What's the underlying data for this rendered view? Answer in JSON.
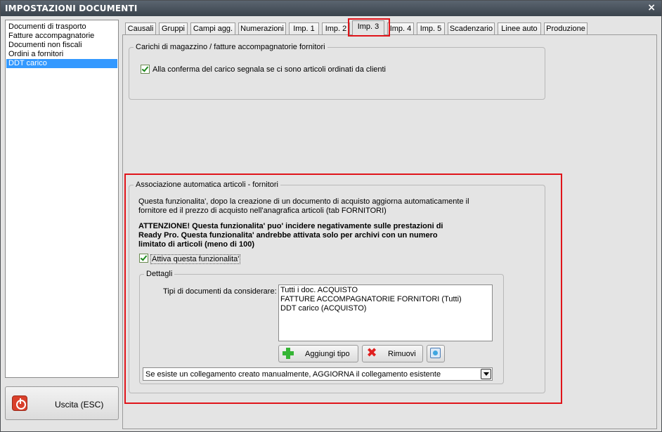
{
  "window": {
    "title": "IMPOSTAZIONI DOCUMENTI",
    "close_glyph": "×"
  },
  "doc_list": [
    {
      "label": "Documenti di trasporto",
      "selected": false
    },
    {
      "label": "Fatture accompagnatorie",
      "selected": false
    },
    {
      "label": "Documenti non fiscali",
      "selected": false
    },
    {
      "label": "Ordini a fornitori",
      "selected": false
    },
    {
      "label": "DDT carico",
      "selected": true
    }
  ],
  "exit_button": {
    "label": "Uscita (ESC)",
    "icon": "power-icon"
  },
  "tabs": [
    {
      "label": "Causali"
    },
    {
      "label": "Gruppi"
    },
    {
      "label": "Campi agg."
    },
    {
      "label": "Numerazioni"
    },
    {
      "label": "Imp. 1"
    },
    {
      "label": "Imp. 2"
    },
    {
      "label": "Imp. 3",
      "active": true
    },
    {
      "label": "Imp. 4"
    },
    {
      "label": "Imp. 5"
    },
    {
      "label": "Scadenzario"
    },
    {
      "label": "Linee auto"
    },
    {
      "label": "Produzione"
    }
  ],
  "carichi": {
    "legend": "Carichi di magazzino / fatture accompagnatorie fornitori",
    "checkbox_label": "Alla conferma del carico segnala se ci sono articoli ordinati da clienti",
    "checked": true
  },
  "associazione": {
    "legend": "Associazione automatica articoli - fornitori",
    "desc_line1": "Questa funzionalita', dopo la creazione di un documento di acquisto aggiorna automaticamente il",
    "desc_line2": "fornitore ed il prezzo di acquisto nell'anagrafica articoli (tab FORNITORI)",
    "warn_line1": "ATTENZIONE! Questa funzionalita' puo' incidere negativamente sulle prestazioni di",
    "warn_line2": "Ready Pro. Questa funzionalita' andrebbe attivata solo per archivi con un numero",
    "warn_line3": "limitato di articoli (meno di 100)",
    "activate_label": "Attiva questa funzionalita'",
    "activate_checked": true
  },
  "dettagli": {
    "legend": "Dettagli",
    "types_label": "Tipi di documenti da considerare:",
    "types": [
      "Tutti i doc. ACQUISTO",
      "FATTURE ACCOMPAGNATORIE FORNITORI (Tutti)",
      "DDT carico (ACQUISTO)"
    ],
    "add_label": "Aggiungi tipo",
    "remove_label": "Rimuovi",
    "link_option": "Se esiste un collegamento creato manualmente, AGGIORNA il collegamento esistente"
  },
  "highlight_color": "#e0141a"
}
